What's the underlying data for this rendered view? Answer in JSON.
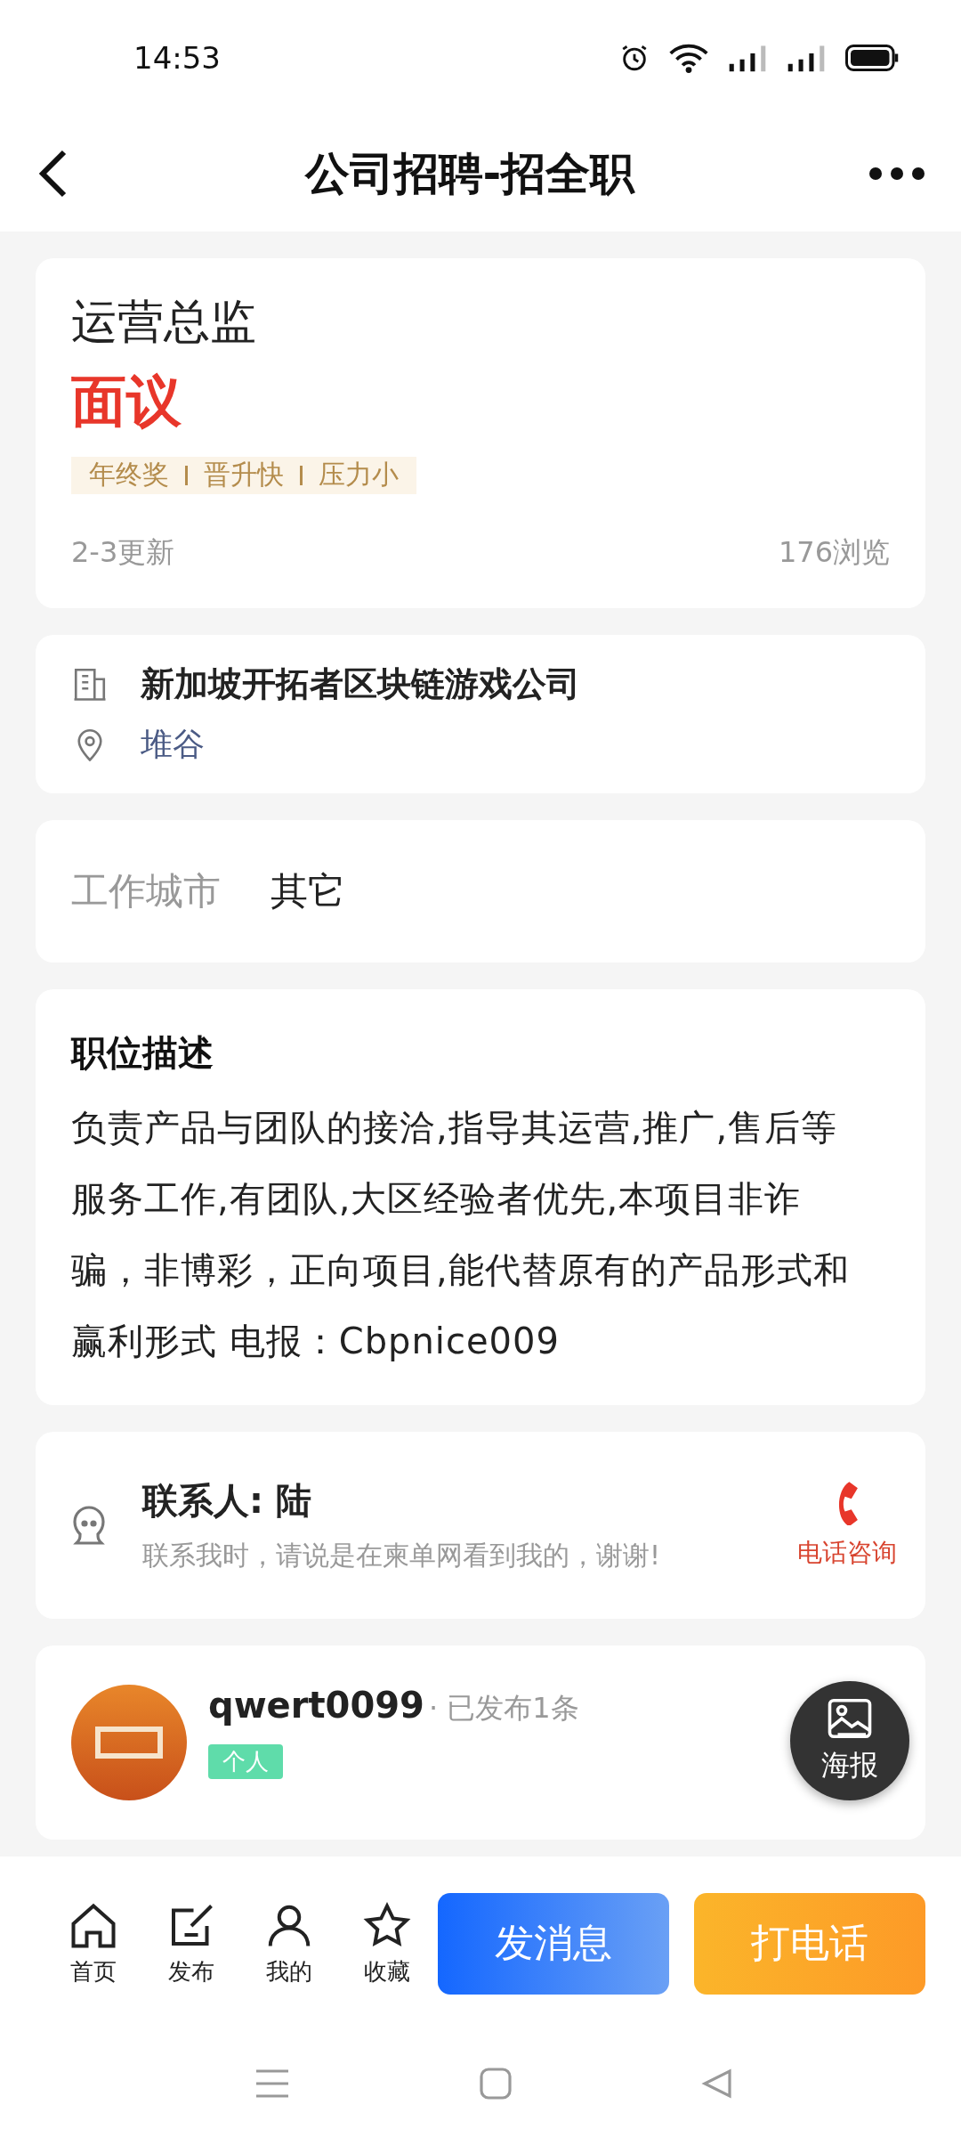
{
  "status_bar": {
    "time": "14:53"
  },
  "nav": {
    "title": "公司招聘-招全职"
  },
  "job": {
    "title": "运营总监",
    "salary": "面议",
    "tags": [
      "年终奖",
      "晋升快",
      "压力小"
    ],
    "updated": "2-3更新",
    "views": "176浏览"
  },
  "company": {
    "name": "新加坡开拓者区块链游戏公司",
    "location": "堆谷"
  },
  "city": {
    "label": "工作城市",
    "value": "其它"
  },
  "description": {
    "heading": "职位描述",
    "text": "负责产品与团队的接洽,指导其运营,推广,售后等服务工作,有团队,大区经验者优先,本项目非诈骗，非博彩，正向项目,能代替原有的产品形式和赢利形式 电报：Cbpnice009"
  },
  "contact": {
    "name": "联系人: 陆",
    "note": "联系我时，请说是在柬单网看到我的，谢谢!",
    "call_label": "电话咨询"
  },
  "poster": {
    "label": "海报"
  },
  "publisher": {
    "name": "qwert0099",
    "count": "· 已发布1条",
    "badge": "个人"
  },
  "bottom_bar": {
    "items": [
      {
        "kind": "home",
        "label": "首页"
      },
      {
        "kind": "post",
        "label": "发布"
      },
      {
        "kind": "me",
        "label": "我的"
      },
      {
        "kind": "favorite",
        "label": "收藏"
      }
    ],
    "message_button": "发消息",
    "call_button": "打电话"
  }
}
